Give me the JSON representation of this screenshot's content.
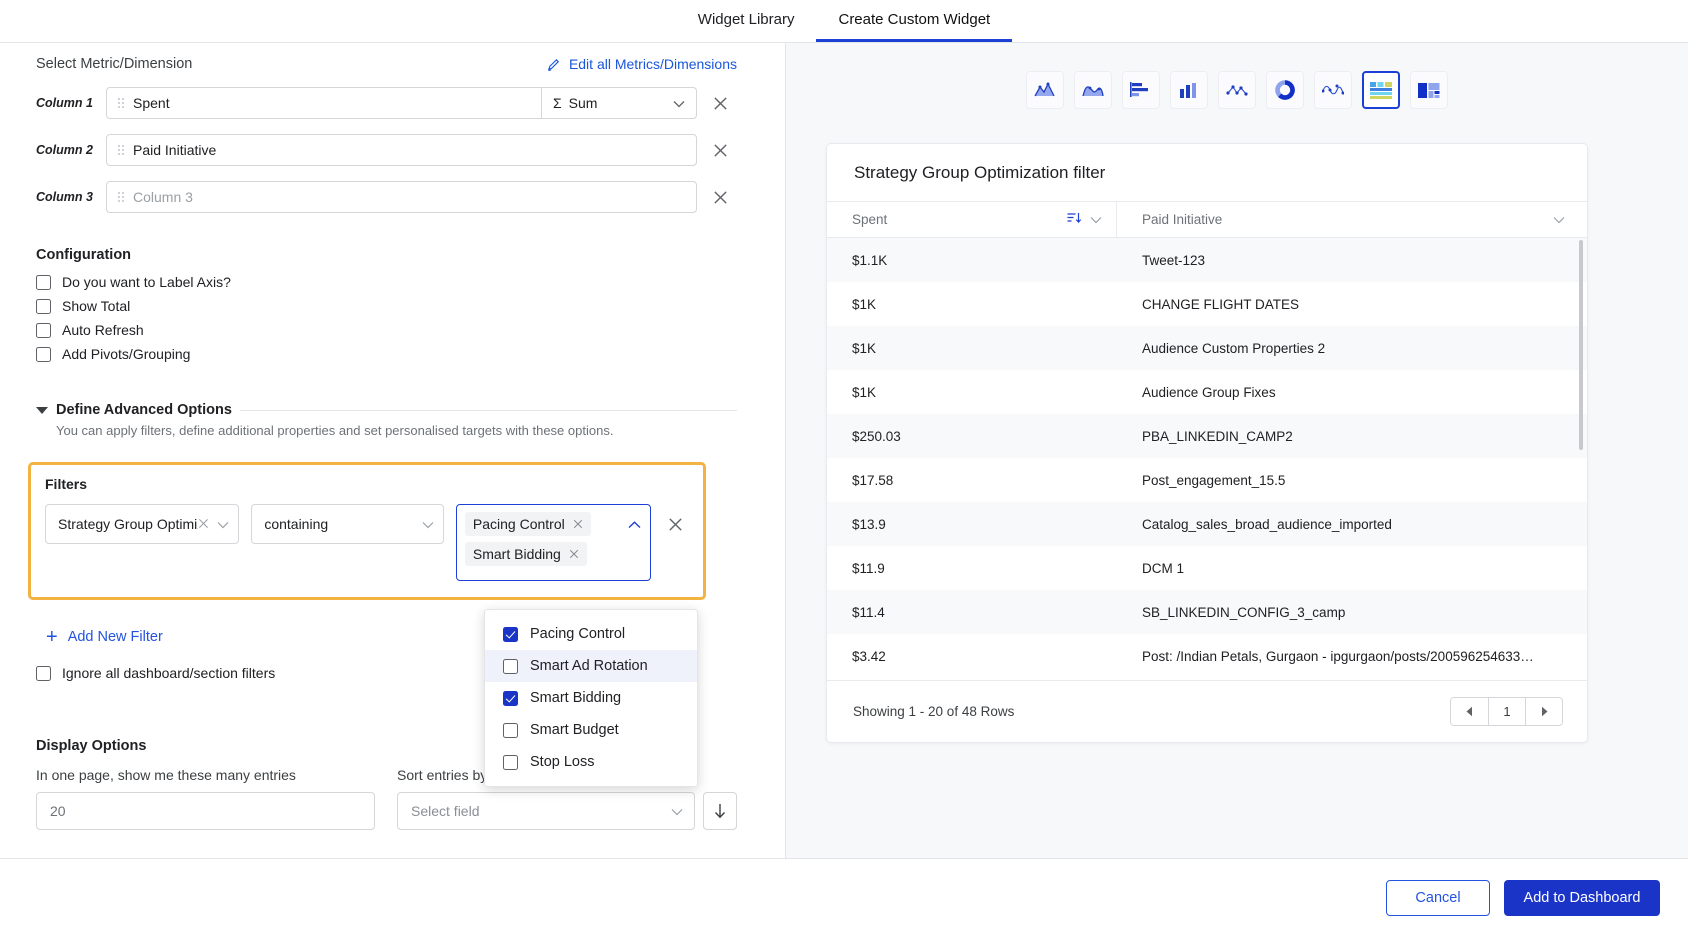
{
  "tabs": [
    {
      "label": "Widget Library",
      "active": false
    },
    {
      "label": "Create Custom Widget",
      "active": true
    }
  ],
  "metric_section": {
    "title": "Select Metric/Dimension",
    "edit_link": "Edit all Metrics/Dimensions",
    "columns": [
      {
        "label": "Column 1",
        "value": "Spent",
        "placeholder": "",
        "agg": "Sum",
        "agg_symbol": "Σ",
        "has_agg": true
      },
      {
        "label": "Column 2",
        "value": "Paid Initiative",
        "placeholder": "",
        "has_agg": false
      },
      {
        "label": "Column 3",
        "value": "",
        "placeholder": "Column 3",
        "has_agg": false
      }
    ]
  },
  "configuration": {
    "title": "Configuration",
    "options": [
      {
        "label": "Do you want to Label Axis?",
        "checked": false
      },
      {
        "label": "Show Total",
        "checked": false
      },
      {
        "label": "Auto Refresh",
        "checked": false
      },
      {
        "label": "Add Pivots/Grouping",
        "checked": false
      }
    ]
  },
  "advanced": {
    "title": "Define Advanced Options",
    "subtitle": "You can apply filters, define additional properties and set personalised targets with these options."
  },
  "filters": {
    "title": "Filters",
    "field": "Strategy Group Optimizatic",
    "operator": "containing",
    "selected_chips": [
      "Pacing Control",
      "Smart Bidding"
    ],
    "dropdown_options": [
      {
        "label": "Pacing Control",
        "checked": true,
        "hover": false
      },
      {
        "label": "Smart Ad Rotation",
        "checked": false,
        "hover": true
      },
      {
        "label": "Smart Bidding",
        "checked": true,
        "hover": false
      },
      {
        "label": "Smart Budget",
        "checked": false,
        "hover": false
      },
      {
        "label": "Stop Loss",
        "checked": false,
        "hover": false
      }
    ],
    "add_new_filter": "Add New Filter",
    "ignore_label": "Ignore all dashboard/section filters",
    "ignore_checked": false,
    "highlight_color": "#f2b340"
  },
  "display_options": {
    "title": "Display Options",
    "entries_label": "In one page, show me these many entries",
    "entries_value": "20",
    "sort_label": "Sort entries by",
    "sort_placeholder": "Select field"
  },
  "chart_types": [
    {
      "name": "area-chart-icon",
      "selected": false
    },
    {
      "name": "area-spline-chart-icon",
      "selected": false
    },
    {
      "name": "horizontal-bar-chart-icon",
      "selected": false
    },
    {
      "name": "column-chart-icon",
      "selected": false
    },
    {
      "name": "scatter-chart-icon",
      "selected": false
    },
    {
      "name": "donut-chart-icon",
      "selected": false
    },
    {
      "name": "line-chart-icon",
      "selected": false
    },
    {
      "name": "table-chart-icon",
      "selected": true
    },
    {
      "name": "mixed-layout-chart-icon",
      "selected": false
    }
  ],
  "preview": {
    "title": "Strategy Group Optimization filter",
    "columns": [
      "Spent",
      "Paid Initiative"
    ],
    "rows": [
      {
        "spent": "$1.1K",
        "initiative": "Tweet-123"
      },
      {
        "spent": "$1K",
        "initiative": "CHANGE FLIGHT DATES"
      },
      {
        "spent": "$1K",
        "initiative": "Audience Custom Properties 2"
      },
      {
        "spent": "$1K",
        "initiative": "Audience Group Fixes"
      },
      {
        "spent": "$250.03",
        "initiative": "PBA_LINKEDIN_CAMP2"
      },
      {
        "spent": "$17.58",
        "initiative": "Post_engagement_15.5"
      },
      {
        "spent": "$13.9",
        "initiative": "Catalog_sales_broad_audience_imported"
      },
      {
        "spent": "$11.9",
        "initiative": "DCM 1"
      },
      {
        "spent": "$11.4",
        "initiative": "SB_LINKEDIN_CONFIG_3_camp"
      },
      {
        "spent": "$3.42",
        "initiative": "Post: /Indian Petals, Gurgaon - ipgurgaon/posts/200596254633…"
      }
    ],
    "showing": "Showing 1 - 20 of 48 Rows",
    "page": "1"
  },
  "footer": {
    "cancel": "Cancel",
    "submit": "Add to Dashboard"
  },
  "colors": {
    "accent_blue": "#1a34c8",
    "link_blue": "#2353e0",
    "highlight_orange": "#f2b340"
  }
}
